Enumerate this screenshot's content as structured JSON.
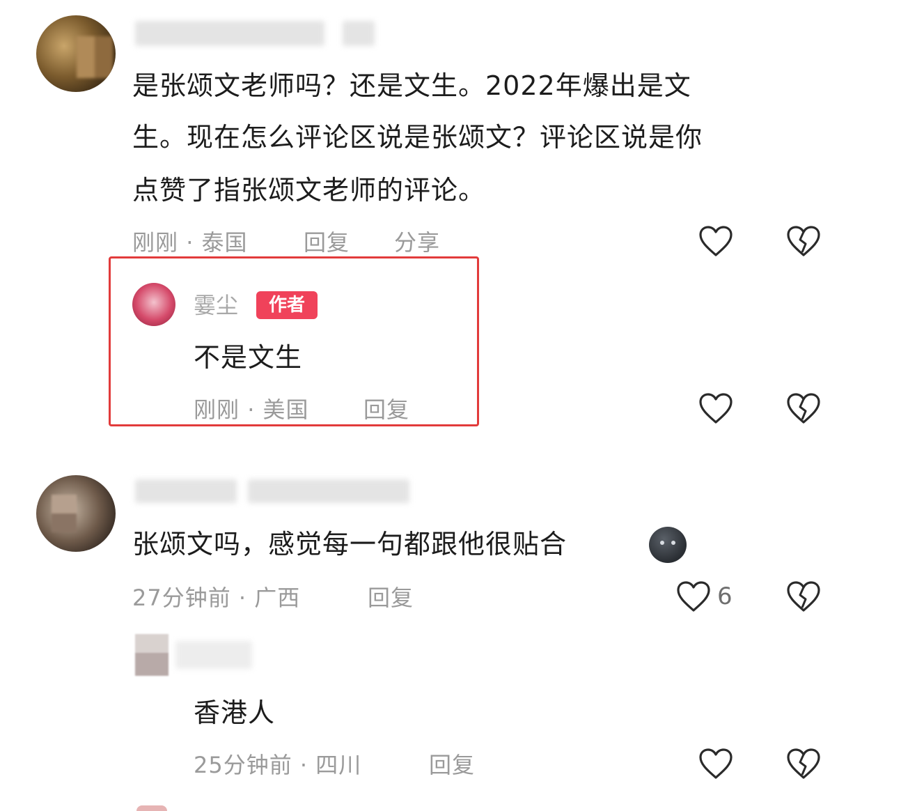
{
  "comments": [
    {
      "text_lines": [
        "是张颂文老师吗？还是文生。2022年爆出是文",
        "生。现在怎么评论区说是张颂文？评论区说是你",
        "点赞了指张颂文老师的评论。"
      ],
      "time": "刚刚",
      "location": "泰国",
      "reply_label": "回复",
      "share_label": "分享",
      "like_icon": "heart-outline-icon",
      "dislike_icon": "broken-heart-icon"
    },
    {
      "author_name": "霎尘",
      "author_badge": "作者",
      "text": "不是文生",
      "time": "刚刚",
      "location": "美国",
      "reply_label": "回复",
      "highlight_color": "#e23b3b"
    },
    {
      "text": "张颂文吗，感觉每一句都跟他很贴合",
      "emoji": "dark-round-face-emoji",
      "time": "27分钟前",
      "location": "广西",
      "reply_label": "回复",
      "like_count": "6"
    },
    {
      "text": "香港人",
      "time": "25分钟前",
      "location": "四川",
      "reply_label": "回复"
    }
  ],
  "meta_separator": "·",
  "colors": {
    "badge": "#f0425a",
    "highlight": "#e23b3b",
    "meta_text": "#9a9a9a"
  }
}
